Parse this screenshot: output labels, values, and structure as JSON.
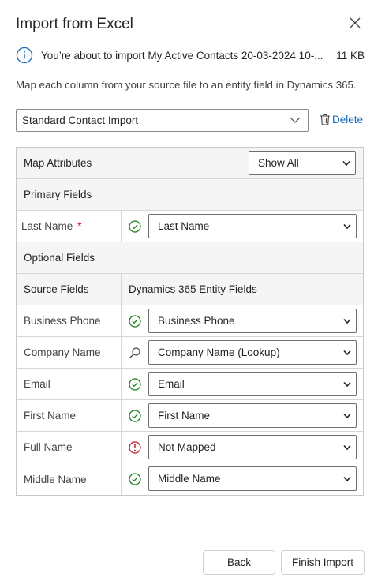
{
  "dialog": {
    "title": "Import from Excel",
    "close_icon": "close-icon"
  },
  "info": {
    "icon": "info-icon",
    "message": "You’re about to import My Active Contacts 20-03-2024 10-...",
    "size": "11 KB"
  },
  "description": "Map each column from your source file to an entity field in Dynamics 365.",
  "template": {
    "selected": "Standard Contact Import",
    "delete_label": "Delete"
  },
  "grid": {
    "map_attributes_label": "Map Attributes",
    "filter_selected": "Show All",
    "primary_section": "Primary Fields",
    "optional_section": "Optional Fields",
    "source_header": "Source Fields",
    "target_header": "Dynamics 365 Entity Fields",
    "primary_rows": [
      {
        "source": "Last Name",
        "required": "*",
        "status": "check-icon",
        "target": "Last Name"
      }
    ],
    "optional_rows": [
      {
        "source": "Business Phone",
        "status": "check-icon",
        "target": "Business Phone"
      },
      {
        "source": "Company Name",
        "status": "search-icon",
        "target": "Company Name (Lookup)"
      },
      {
        "source": "Email",
        "status": "check-icon",
        "target": "Email"
      },
      {
        "source": "First Name",
        "status": "check-icon",
        "target": "First Name"
      },
      {
        "source": "Full Name",
        "status": "warning-icon",
        "target": "Not Mapped"
      },
      {
        "source": "Middle Name",
        "status": "check-icon",
        "target": "Middle Name"
      }
    ]
  },
  "footer": {
    "back_label": "Back",
    "finish_label": "Finish Import"
  },
  "colors": {
    "accent": "#0f6cbd",
    "success": "#107c10",
    "danger": "#c50f1f"
  }
}
